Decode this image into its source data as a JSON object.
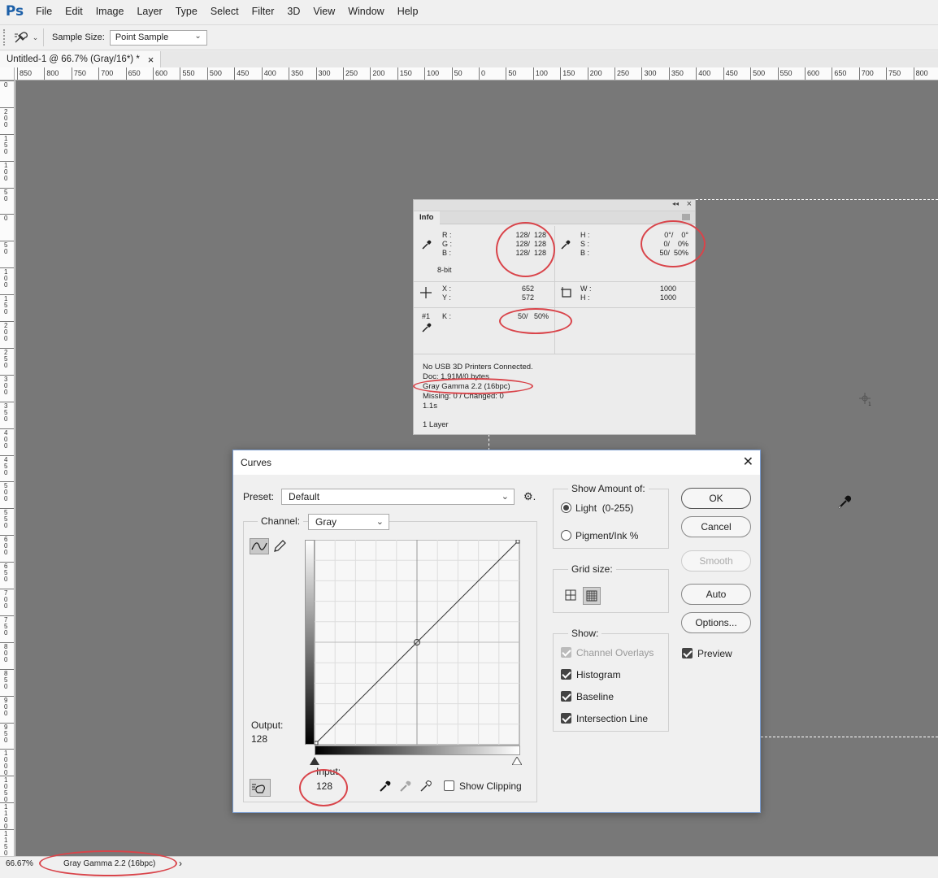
{
  "app": {
    "logo": "Ps",
    "menu": [
      "File",
      "Edit",
      "Image",
      "Layer",
      "Type",
      "Select",
      "Filter",
      "3D",
      "View",
      "Window",
      "Help"
    ]
  },
  "options_bar": {
    "tool_icon": "eyedropper-icon",
    "sample_size_label": "Sample Size:",
    "sample_size_value": "Point Sample"
  },
  "document": {
    "tab_title": "Untitled-1 @ 66.7% (Gray/16*) *",
    "close": "×"
  },
  "rulers": {
    "horizontal": [
      "850",
      "800",
      "750",
      "700",
      "650",
      "600",
      "550",
      "500",
      "450",
      "400",
      "350",
      "300",
      "250",
      "200",
      "150",
      "100",
      "50",
      "0",
      "50",
      "100",
      "150",
      "200",
      "250",
      "300",
      "350",
      "400",
      "450",
      "500",
      "550",
      "600",
      "650",
      "700",
      "750",
      "800"
    ],
    "vertical": [
      "0",
      "2 0 0",
      "1 5 0",
      "1 0 0",
      "5 0",
      "0",
      "5 0",
      "1 0 0",
      "1 5 0",
      "2 0 0",
      "2 5 0",
      "3 0 0",
      "3 5 0",
      "4 0 0",
      "4 5 0",
      "5 0 0",
      "5 5 0",
      "6 0 0",
      "6 5 0",
      "7 0 0",
      "7 5 0",
      "8 0 0",
      "8 5 0",
      "9 0 0",
      "9 5 0",
      "1 0 0 0",
      "1 0 5 0",
      "1 1 0 0",
      "1 1 5 0"
    ]
  },
  "status_bar": {
    "zoom": "66.67%",
    "profile": "Gray Gamma 2.2 (16bpc)",
    "arrow": "›"
  },
  "info_panel": {
    "tab": "Info",
    "collapse": "◂◂",
    "close": "×",
    "rgb_labels": [
      "R :",
      "G :",
      "B :"
    ],
    "rgb_values": [
      "128/  128",
      "128/  128",
      "128/  128"
    ],
    "bit_depth": "8-bit",
    "hsb_labels": [
      "H :",
      "S :",
      "B :"
    ],
    "hsb_values": [
      "0°/    0°",
      "0/    0%",
      "50/  50%"
    ],
    "xy_labels": [
      "X :",
      "Y :"
    ],
    "xy_values": [
      "652",
      "572"
    ],
    "wh_labels": [
      "W :",
      "H :"
    ],
    "wh_values": [
      "1000",
      "1000"
    ],
    "sampler_label": "#1",
    "k_label": "K :",
    "k_value": "50/   50%",
    "info_lines": [
      "No USB 3D Printers Connected.",
      "Doc: 1.91M/0 bytes",
      "Gray Gamma 2.2 (16bpc)",
      "Missing: 0 / Changed: 0",
      "1.1s"
    ],
    "layers": "1 Layer"
  },
  "curves": {
    "title": "Curves",
    "close": "✕",
    "preset_label": "Preset:",
    "preset_value": "Default",
    "channel_label": "Channel:",
    "channel_value": "Gray",
    "output_label": "Output:",
    "output_value": "128",
    "input_label": "Input:",
    "input_value": "128",
    "show_clipping": "Show Clipping",
    "show_amount_title": "Show Amount of:",
    "light_option": "Light  (0-255)",
    "pigment_option": "Pigment/Ink %",
    "grid_size_title": "Grid size:",
    "show_title": "Show:",
    "show_options": [
      "Channel Overlays",
      "Histogram",
      "Baseline",
      "Intersection Line"
    ],
    "buttons": {
      "ok": "OK",
      "cancel": "Cancel",
      "smooth": "Smooth",
      "auto": "Auto",
      "options": "Options..."
    },
    "preview": "Preview"
  },
  "colors": {
    "canvas": "#787878",
    "annotation": "#d9444a",
    "ps_blue": "#1b5fa8"
  }
}
